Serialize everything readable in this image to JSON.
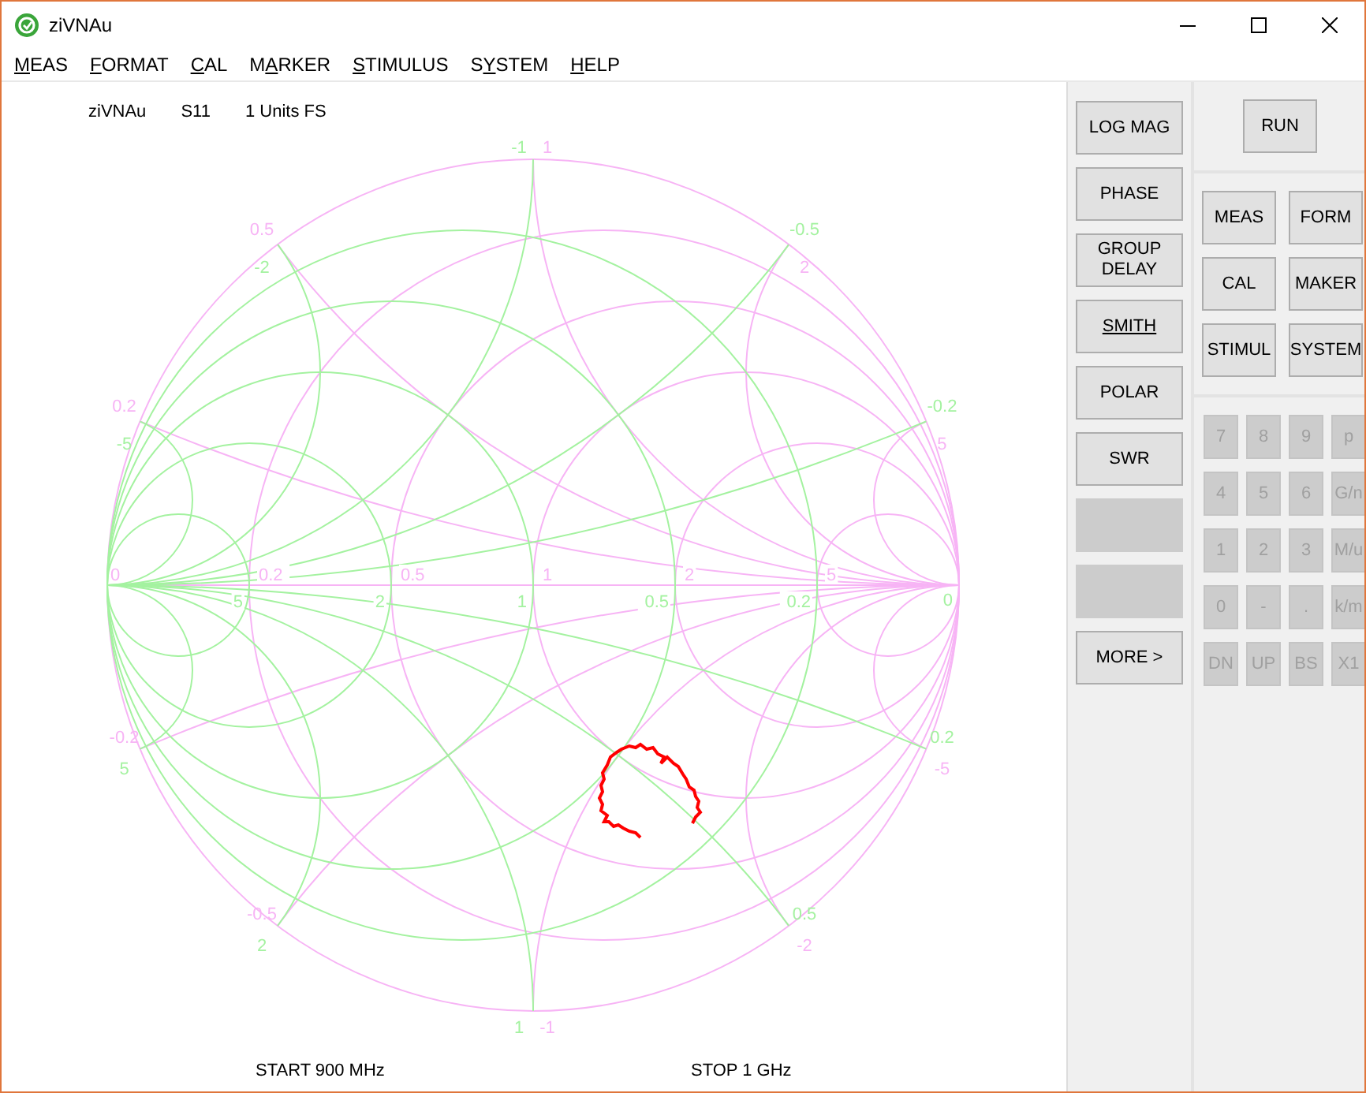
{
  "window": {
    "title": "ziVNAu"
  },
  "menu": [
    {
      "key": "M",
      "after": "EAS"
    },
    {
      "key": "F",
      "after": "ORMAT"
    },
    {
      "key": "C",
      "after": "AL"
    },
    {
      "before": "M",
      "key": "A",
      "after": "RKER"
    },
    {
      "key": "S",
      "after": "TIMULUS"
    },
    {
      "before": "S",
      "key": "Y",
      "after": "STEM"
    },
    {
      "key": "H",
      "after": "ELP"
    }
  ],
  "plot": {
    "header": [
      "ziVNAu",
      "S11",
      "1 Units FS"
    ],
    "start": "START 900 MHz",
    "stop": "STOP 1 GHz",
    "impedance_labels": {
      "zero": "0",
      "resistance": [
        "0.2",
        "0.5",
        "1",
        "2",
        "5"
      ],
      "reactance_upper": [
        "0.2",
        "0.5",
        "1",
        "2",
        "5"
      ],
      "reactance_lower": [
        "-0.2",
        "-0.5",
        "-1",
        "-2",
        "-5"
      ]
    },
    "admittance_labels": {
      "zero": "0",
      "conductance": [
        "5",
        "2",
        "1",
        "0.5",
        "0.2"
      ],
      "susceptance_upper": [
        "-5",
        "-2",
        "-1",
        "-0.5",
        "-0.2"
      ],
      "susceptance_lower": [
        "5",
        "2",
        "1",
        "0.5",
        "0.2"
      ]
    }
  },
  "format_buttons": [
    {
      "kind": "button",
      "label": "LOG MAG",
      "selected": false
    },
    {
      "kind": "button",
      "label": "PHASE",
      "selected": false
    },
    {
      "kind": "button",
      "label": "GROUP DELAY",
      "selected": false
    },
    {
      "kind": "button",
      "label": "SMITH",
      "selected": true
    },
    {
      "kind": "button",
      "label": "POLAR",
      "selected": false
    },
    {
      "kind": "button",
      "label": "SWR",
      "selected": false
    },
    {
      "kind": "blank"
    },
    {
      "kind": "blank"
    },
    {
      "kind": "button",
      "label": "MORE >",
      "selected": false
    }
  ],
  "run_button": "RUN",
  "menu_buttons": [
    "MEAS",
    "FORM",
    "CAL",
    "MAKER",
    "STIMUL",
    "SYSTEM"
  ],
  "keypad": [
    {
      "label": "7",
      "disabled": true
    },
    {
      "label": "8",
      "disabled": true
    },
    {
      "label": "9",
      "disabled": true
    },
    {
      "label": "p",
      "disabled": true
    },
    {
      "label": "4",
      "disabled": true
    },
    {
      "label": "5",
      "disabled": true
    },
    {
      "label": "6",
      "disabled": true
    },
    {
      "label": "G/n",
      "disabled": true
    },
    {
      "label": "1",
      "disabled": true
    },
    {
      "label": "2",
      "disabled": true
    },
    {
      "label": "3",
      "disabled": true
    },
    {
      "label": "M/u",
      "disabled": true
    },
    {
      "label": "0",
      "disabled": true
    },
    {
      "label": "-",
      "disabled": true
    },
    {
      "label": ".",
      "disabled": true
    },
    {
      "label": "k/m",
      "disabled": true
    },
    {
      "label": "DN",
      "disabled": true
    },
    {
      "label": "UP",
      "disabled": true
    },
    {
      "label": "BS",
      "disabled": true
    },
    {
      "label": "X1",
      "disabled": true
    }
  ]
}
